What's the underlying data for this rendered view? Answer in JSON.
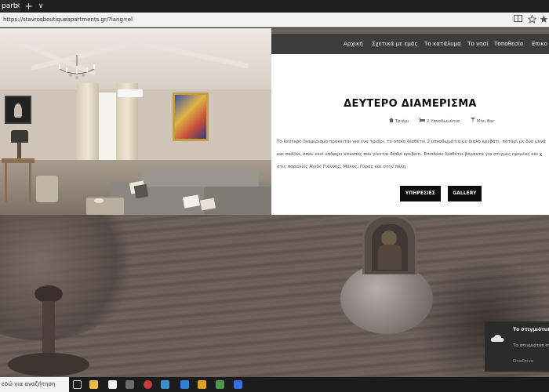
{
  "browser": {
    "tab_title": "partı",
    "tab_close": "×",
    "new_tab": "+",
    "tab_list": "∨",
    "url": "https://stavrosboutiqueapartments.gr/?lang=el"
  },
  "site_nav": {
    "items": [
      "Αρχική",
      "Σχετικά με εμάς",
      "Το κατάλυμα",
      "Το νησί",
      "Τοποθεσία",
      "Επικο"
    ]
  },
  "apartment": {
    "title": "ΔΕΥΤΕΡΟ ΔΙΑΜΕΡΙΣΜΑ",
    "meta": {
      "rooms": "Τριάρι",
      "bedrooms": "2 Υπνοδωμάτια",
      "bar": "Μίνι Bar"
    },
    "description": [
      "Το δεύτερο διαμέρισμα πρόκειται για ένα τριάρι, το οποίο διαθέτει 2 υπνοδωμάτια με διπλό κρεβάτι, πατάρι με δύο μονά",
      "και σαλόνι, όπου εκεί υπάρχει καναπές που γίνεται διπλό κρεβάτι. Επιπλέον διαθέτει βεράντα για στιγμές ηρεμίας και χ",
      "στις παραλίες Άγιος Γιάννης, Μύλος, Γύρας και στην πόλη"
    ],
    "buttons": {
      "services": "ΥΠΗΡΕΣΙΕΣ",
      "gallery": "GALLERY"
    }
  },
  "toast": {
    "title": "Το στιγμιότυπ αποθηκεύτηκ",
    "body": "Το στιγμιότυπ στο OneDrive.",
    "source": "OneDrive"
  },
  "taskbar": {
    "search_text": "εδώ για αναζήτηση"
  },
  "colors": {
    "nav_bar": "#3c3c3c",
    "button": "#0d0d0d",
    "taskbar": "#1b1b1b",
    "toast": "#2b2b2b"
  }
}
